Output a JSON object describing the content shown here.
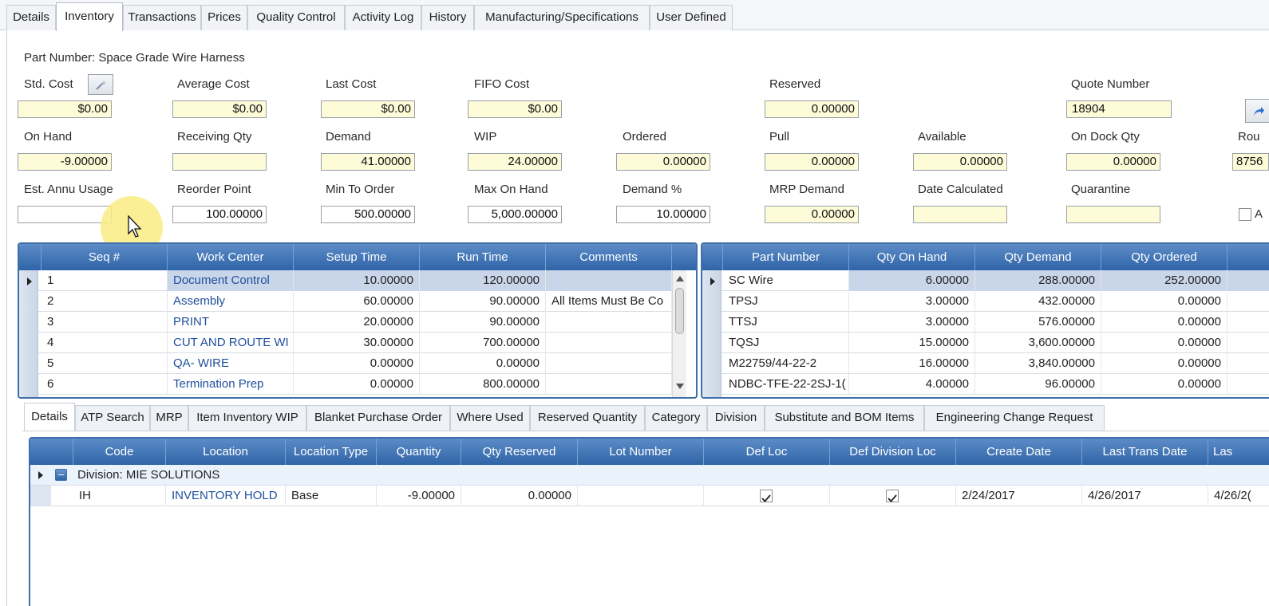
{
  "top_tabs": [
    "Details",
    "Inventory",
    "Transactions",
    "Prices",
    "Quality Control",
    "Activity Log",
    "History",
    "Manufacturing/Specifications",
    "User Defined"
  ],
  "active_top_tab": "Inventory",
  "part_number_label": "Part Number: Space Grade Wire Harness",
  "fields": {
    "std_cost": {
      "label": "Std. Cost",
      "value": "$0.00"
    },
    "average_cost": {
      "label": "Average Cost",
      "value": "$0.00"
    },
    "last_cost": {
      "label": "Last Cost",
      "value": "$0.00"
    },
    "fifo_cost": {
      "label": "FIFO Cost",
      "value": "$0.00"
    },
    "reserved": {
      "label": "Reserved",
      "value": "0.00000"
    },
    "quote_number": {
      "label": "Quote Number",
      "value": "18904"
    },
    "on_hand": {
      "label": "On Hand",
      "value": "-9.00000"
    },
    "receiving_qty": {
      "label": "Receiving Qty",
      "value": ""
    },
    "demand": {
      "label": "Demand",
      "value": "41.00000"
    },
    "wip": {
      "label": "WIP",
      "value": "24.00000"
    },
    "ordered": {
      "label": "Ordered",
      "value": "0.00000"
    },
    "pull": {
      "label": "Pull",
      "value": "0.00000"
    },
    "available": {
      "label": "Available",
      "value": "0.00000"
    },
    "on_dock_qty": {
      "label": "On Dock Qty",
      "value": "0.00000"
    },
    "route": {
      "label": "Rou",
      "value": "8756"
    },
    "est_annu_usage": {
      "label": "Est. Annu Usage",
      "value": ""
    },
    "reorder_point": {
      "label": "Reorder Point",
      "value": "100.00000"
    },
    "min_to_order": {
      "label": "Min To  Order",
      "value": "500.00000"
    },
    "max_on_hand": {
      "label": "Max On Hand",
      "value": "5,000.00000"
    },
    "demand_pct": {
      "label": "Demand %",
      "value": "10.00000"
    },
    "mrp_demand": {
      "label": "MRP Demand",
      "value": "0.00000"
    },
    "date_calculated": {
      "label": "Date Calculated",
      "value": ""
    },
    "quarantine": {
      "label": "Quarantine",
      "value": ""
    },
    "trailing_checkbox_label": "A"
  },
  "routing_grid": {
    "headers": [
      "Seq #",
      "Work Center",
      "Setup Time",
      "Run Time",
      "Comments"
    ],
    "rows": [
      {
        "seq": "1",
        "work_center": "Document Control",
        "setup": "10.00000",
        "run": "120.00000",
        "comments": ""
      },
      {
        "seq": "2",
        "work_center": "Assembly",
        "setup": "60.00000",
        "run": "90.00000",
        "comments": "All Items Must Be Co"
      },
      {
        "seq": "3",
        "work_center": "PRINT",
        "setup": "20.00000",
        "run": "90.00000",
        "comments": ""
      },
      {
        "seq": "4",
        "work_center": "CUT AND ROUTE WI",
        "setup": "30.00000",
        "run": "700.00000",
        "comments": ""
      },
      {
        "seq": "5",
        "work_center": "QA- WIRE",
        "setup": "0.00000",
        "run": "0.00000",
        "comments": ""
      },
      {
        "seq": "6",
        "work_center": "Termination Prep",
        "setup": "0.00000",
        "run": "800.00000",
        "comments": ""
      }
    ]
  },
  "bom_grid": {
    "headers": [
      "Part Number",
      "Qty On Hand",
      "Qty Demand",
      "Qty Ordered"
    ],
    "rows": [
      {
        "part": "SC Wire",
        "on_hand": "6.00000",
        "demand": "288.00000",
        "ordered": "252.00000"
      },
      {
        "part": "TPSJ",
        "on_hand": "3.00000",
        "demand": "432.00000",
        "ordered": "0.00000"
      },
      {
        "part": "TTSJ",
        "on_hand": "3.00000",
        "demand": "576.00000",
        "ordered": "0.00000"
      },
      {
        "part": "TQSJ",
        "on_hand": "15.00000",
        "demand": "3,600.00000",
        "ordered": "0.00000"
      },
      {
        "part": "M22759/44-22-2",
        "on_hand": "16.00000",
        "demand": "3,840.00000",
        "ordered": "0.00000"
      },
      {
        "part": "NDBC-TFE-22-2SJ-1(",
        "on_hand": "4.00000",
        "demand": "96.00000",
        "ordered": "0.00000"
      }
    ]
  },
  "sub_tabs": [
    "Details",
    "ATP Search",
    "MRP",
    "Item Inventory WIP",
    "Blanket Purchase Order",
    "Where Used",
    "Reserved Quantity",
    "Category",
    "Division",
    "Substitute and BOM Items",
    "Engineering Change Request"
  ],
  "active_sub_tab": "Details",
  "location_grid": {
    "headers": [
      "Code",
      "Location",
      "Location Type",
      "Quantity",
      "Qty Reserved",
      "Lot Number",
      "Def Loc",
      "Def Division Loc",
      "Create Date",
      "Last Trans Date",
      "Las"
    ],
    "group_label": "Division: MIE SOLUTIONS",
    "rows": [
      {
        "code": "IH",
        "location": "INVENTORY HOLD",
        "type": "Base",
        "quantity": "-9.00000",
        "reserved": "0.00000",
        "lot": "",
        "def_loc": true,
        "def_div_loc": true,
        "create_date": "2/24/2017",
        "last_trans": "4/26/2017",
        "last": "4/26/2("
      }
    ]
  }
}
